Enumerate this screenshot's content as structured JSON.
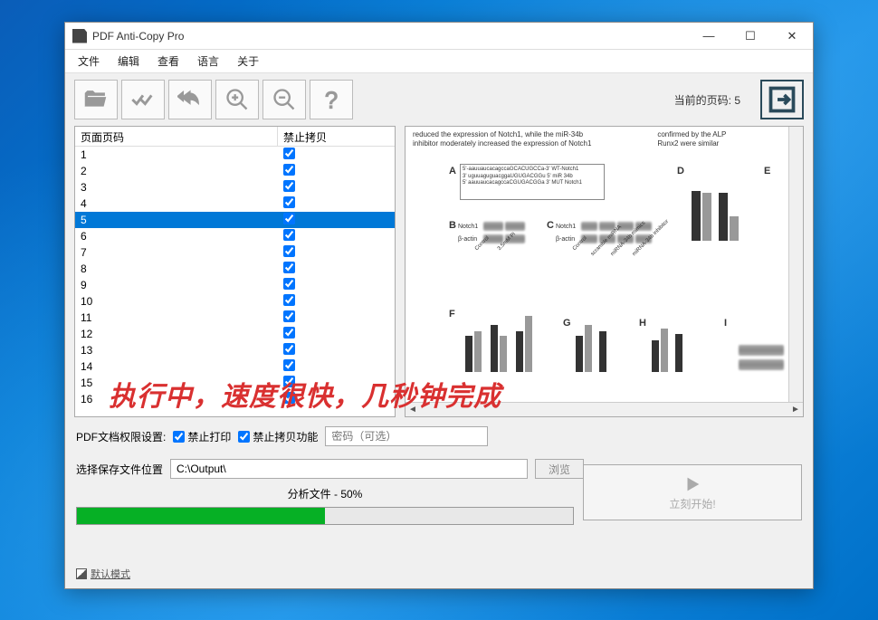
{
  "window": {
    "title": "PDF Anti-Copy Pro"
  },
  "menu": {
    "file": "文件",
    "edit": "编辑",
    "view": "查看",
    "language": "语言",
    "about": "关于"
  },
  "toolbar": {
    "current_page_label": "当前的页码: 5"
  },
  "list": {
    "col_page": "页面页码",
    "col_nocopy": "禁止拷贝",
    "selected_index": 4,
    "rows": [
      {
        "n": "1",
        "c": true
      },
      {
        "n": "2",
        "c": true
      },
      {
        "n": "3",
        "c": true
      },
      {
        "n": "4",
        "c": true
      },
      {
        "n": "5",
        "c": true
      },
      {
        "n": "6",
        "c": true
      },
      {
        "n": "7",
        "c": true
      },
      {
        "n": "8",
        "c": true
      },
      {
        "n": "9",
        "c": true
      },
      {
        "n": "10",
        "c": true
      },
      {
        "n": "11",
        "c": true
      },
      {
        "n": "12",
        "c": true
      },
      {
        "n": "13",
        "c": true
      },
      {
        "n": "14",
        "c": true
      },
      {
        "n": "15",
        "c": true
      },
      {
        "n": "16",
        "c": true
      }
    ]
  },
  "preview": {
    "line1": "reduced the expression of Notch1, while the miR-34b",
    "line2": "inhibitor moderately increased the expression of Notch1",
    "line1b": "confirmed by the ALP",
    "line2b": "Runx2 were similar"
  },
  "opts": {
    "label": "PDF文档权限设置:",
    "noprint": "禁止打印",
    "nocopy": "禁止拷贝功能",
    "pwd_placeholder": "密码（可选）"
  },
  "save": {
    "label": "选择保存文件位置",
    "path": "C:\\Output\\",
    "browse": "浏览"
  },
  "analyze": {
    "text": "分析文件 - 50%",
    "percent": 50
  },
  "start": {
    "label": "立刻开始!"
  },
  "footer": {
    "text": "默认模式"
  },
  "overlay": "执行中，速度很快，几秒钟完成"
}
